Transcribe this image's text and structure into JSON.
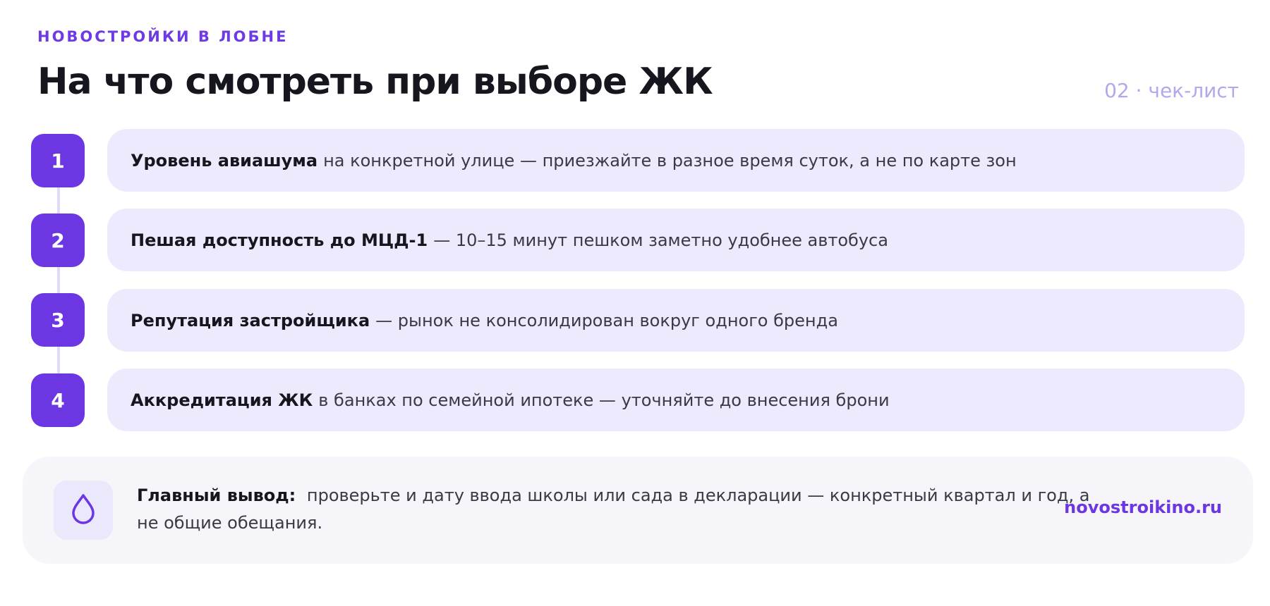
{
  "header": {
    "eyebrow": "НОВОСТРОЙКИ В ЛОБНЕ",
    "title": "На что смотреть при выборе ЖК",
    "page_marker": "02 · чек-лист"
  },
  "steps": [
    {
      "number": "1",
      "title": "Уровень авиашума",
      "text": "на конкретной улице — приезжайте в разное время суток, а не по карте зон"
    },
    {
      "number": "2",
      "title": "Пешая доступность до МЦД-1",
      "text": "— 10–15 минут пешком заметно удобнее автобуса"
    },
    {
      "number": "3",
      "title": "Репутация застройщика",
      "text": "— рынок не консолидирован вокруг одного бренда"
    },
    {
      "number": "4",
      "title": "Аккредитация ЖК",
      "text": "в банках по семейной ипотеке — уточняйте до внесения брони"
    }
  ],
  "summary": {
    "icon": "drop-icon",
    "title": "Главный вывод:",
    "text": "проверьте и дату ввода школы или сада в декларации — конкретный квартал и год, а не общие обещания.",
    "link": "novostroikino.ru"
  },
  "colors": {
    "accent": "#6c36e3",
    "card": "#eeeafd",
    "summary_bg": "#f6f6fa",
    "muted_accent": "#b6a6ec"
  }
}
